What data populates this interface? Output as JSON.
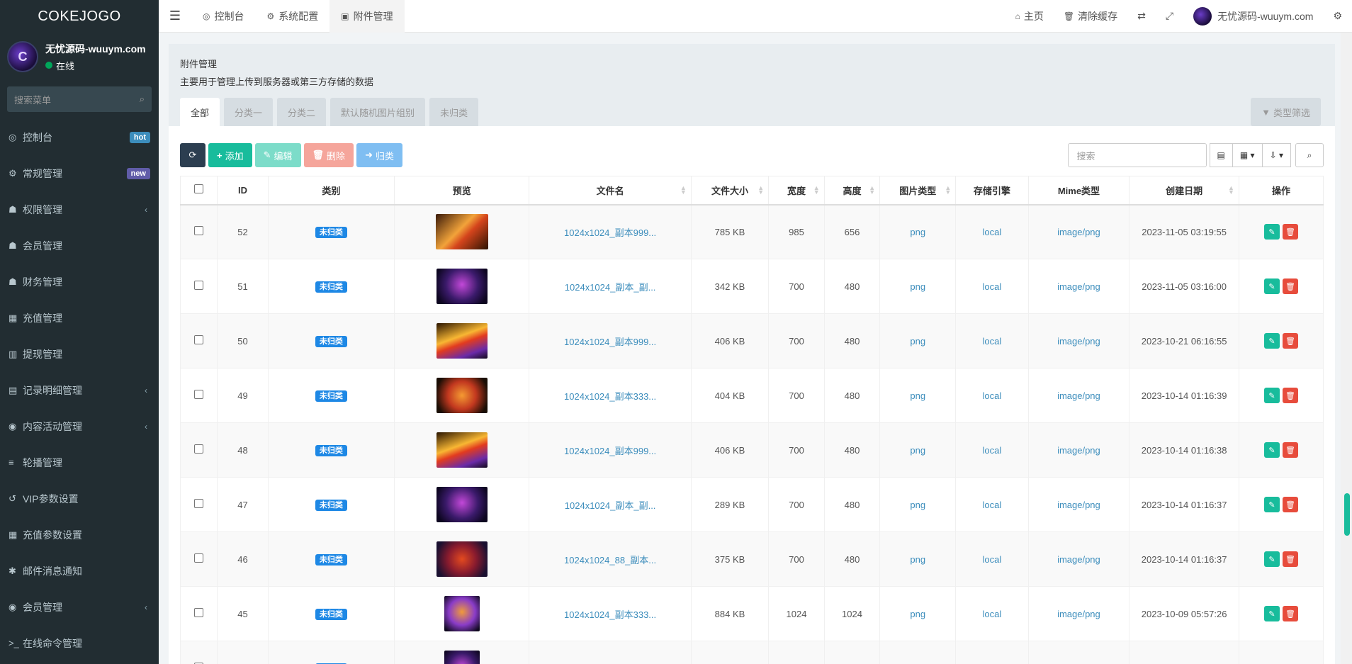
{
  "brand": "COKEJOGO",
  "user": {
    "name": "无忧源码-wuuym.com",
    "status": "在线",
    "avatar_text": "C"
  },
  "sidebar": {
    "search_placeholder": "搜索菜单",
    "items": [
      {
        "label": "控制台",
        "icon": "dashboard-icon",
        "glyph": "◎",
        "badge": "hot"
      },
      {
        "label": "常规管理",
        "icon": "cogs-icon",
        "glyph": "⚙",
        "badge": "new"
      },
      {
        "label": "权限管理",
        "icon": "group-icon",
        "glyph": "☗",
        "chevron": true
      },
      {
        "label": "会员管理",
        "icon": "users-icon",
        "glyph": "☗"
      },
      {
        "label": "财务管理",
        "icon": "users-icon",
        "glyph": "☗"
      },
      {
        "label": "充值管理",
        "icon": "grid-icon",
        "glyph": "▦"
      },
      {
        "label": "提现管理",
        "icon": "bank-icon",
        "glyph": "▥"
      },
      {
        "label": "记录明细管理",
        "icon": "bar-chart-icon",
        "glyph": "▤",
        "chevron": true
      },
      {
        "label": "内容活动管理",
        "icon": "activity-icon",
        "glyph": "◉",
        "chevron": true
      },
      {
        "label": "轮播管理",
        "icon": "list-icon",
        "glyph": "≡"
      },
      {
        "label": "VIP参数设置",
        "icon": "history-icon",
        "glyph": "↺"
      },
      {
        "label": "充值参数设置",
        "icon": "th-icon",
        "glyph": "▦"
      },
      {
        "label": "邮件消息通知",
        "icon": "asterisk-icon",
        "glyph": "✱"
      },
      {
        "label": "会员管理",
        "icon": "user-circle-icon",
        "glyph": "◉",
        "chevron": true
      },
      {
        "label": "在线命令管理",
        "icon": "terminal-icon",
        "glyph": ">_"
      }
    ]
  },
  "header": {
    "tabs": [
      {
        "label": "控制台",
        "glyph": "◎",
        "active": false
      },
      {
        "label": "系统配置",
        "glyph": "⚙",
        "active": false
      },
      {
        "label": "附件管理",
        "glyph": "▣",
        "active": true
      }
    ],
    "home": "主页",
    "clear_cache": "清除缓存",
    "username": "无忧源码-wuuym.com"
  },
  "panel": {
    "title": "附件管理",
    "description": "主要用于管理上传到服务器或第三方存储的数据",
    "tabs": [
      "全部",
      "分类一",
      "分类二",
      "默认随机图片组别",
      "未归类"
    ],
    "filter_button": "类型筛选"
  },
  "toolbar": {
    "add": "添加",
    "edit": "编辑",
    "delete": "删除",
    "classify": "归类",
    "search_placeholder": "搜索"
  },
  "table": {
    "headers": [
      "ID",
      "类别",
      "预览",
      "文件名",
      "文件大小",
      "宽度",
      "高度",
      "图片类型",
      "存储引擎",
      "Mime类型",
      "创建日期",
      "操作"
    ],
    "rows": [
      {
        "id": "52",
        "category": "未归类",
        "filename": "1024x1024_副本999...",
        "size": "785 KB",
        "width": "985",
        "height": "656",
        "type": "png",
        "storage": "local",
        "mime": "image/png",
        "date": "2023-11-05 03:19:55",
        "thumb": "a",
        "tw": 74,
        "th": 50
      },
      {
        "id": "51",
        "category": "未归类",
        "filename": "1024x1024_副本_副...",
        "size": "342 KB",
        "width": "700",
        "height": "480",
        "type": "png",
        "storage": "local",
        "mime": "image/png",
        "date": "2023-11-05 03:16:00",
        "thumb": "b",
        "tw": 72,
        "th": 50
      },
      {
        "id": "50",
        "category": "未归类",
        "filename": "1024x1024_副本999...",
        "size": "406 KB",
        "width": "700",
        "height": "480",
        "type": "png",
        "storage": "local",
        "mime": "image/png",
        "date": "2023-10-21 06:16:55",
        "thumb": "c",
        "tw": 72,
        "th": 50
      },
      {
        "id": "49",
        "category": "未归类",
        "filename": "1024x1024_副本333...",
        "size": "404 KB",
        "width": "700",
        "height": "480",
        "type": "png",
        "storage": "local",
        "mime": "image/png",
        "date": "2023-10-14 01:16:39",
        "thumb": "d",
        "tw": 72,
        "th": 50
      },
      {
        "id": "48",
        "category": "未归类",
        "filename": "1024x1024_副本999...",
        "size": "406 KB",
        "width": "700",
        "height": "480",
        "type": "png",
        "storage": "local",
        "mime": "image/png",
        "date": "2023-10-14 01:16:38",
        "thumb": "c",
        "tw": 72,
        "th": 50
      },
      {
        "id": "47",
        "category": "未归类",
        "filename": "1024x1024_副本_副...",
        "size": "289 KB",
        "width": "700",
        "height": "480",
        "type": "png",
        "storage": "local",
        "mime": "image/png",
        "date": "2023-10-14 01:16:37",
        "thumb": "b",
        "tw": 72,
        "th": 50
      },
      {
        "id": "46",
        "category": "未归类",
        "filename": "1024x1024_88_副本...",
        "size": "375 KB",
        "width": "700",
        "height": "480",
        "type": "png",
        "storage": "local",
        "mime": "image/png",
        "date": "2023-10-14 01:16:37",
        "thumb": "e",
        "tw": 72,
        "th": 50
      },
      {
        "id": "45",
        "category": "未归类",
        "filename": "1024x1024_副本333...",
        "size": "884 KB",
        "width": "1024",
        "height": "1024",
        "type": "png",
        "storage": "local",
        "mime": "image/png",
        "date": "2023-10-09 05:57:26",
        "thumb": "f",
        "tw": 50,
        "th": 50
      },
      {
        "id": "",
        "category": "未归类",
        "filename": "",
        "size": "",
        "width": "",
        "height": "",
        "type": "",
        "storage": "",
        "mime": "",
        "date": "",
        "thumb": "b",
        "tw": 50,
        "th": 50
      }
    ]
  }
}
